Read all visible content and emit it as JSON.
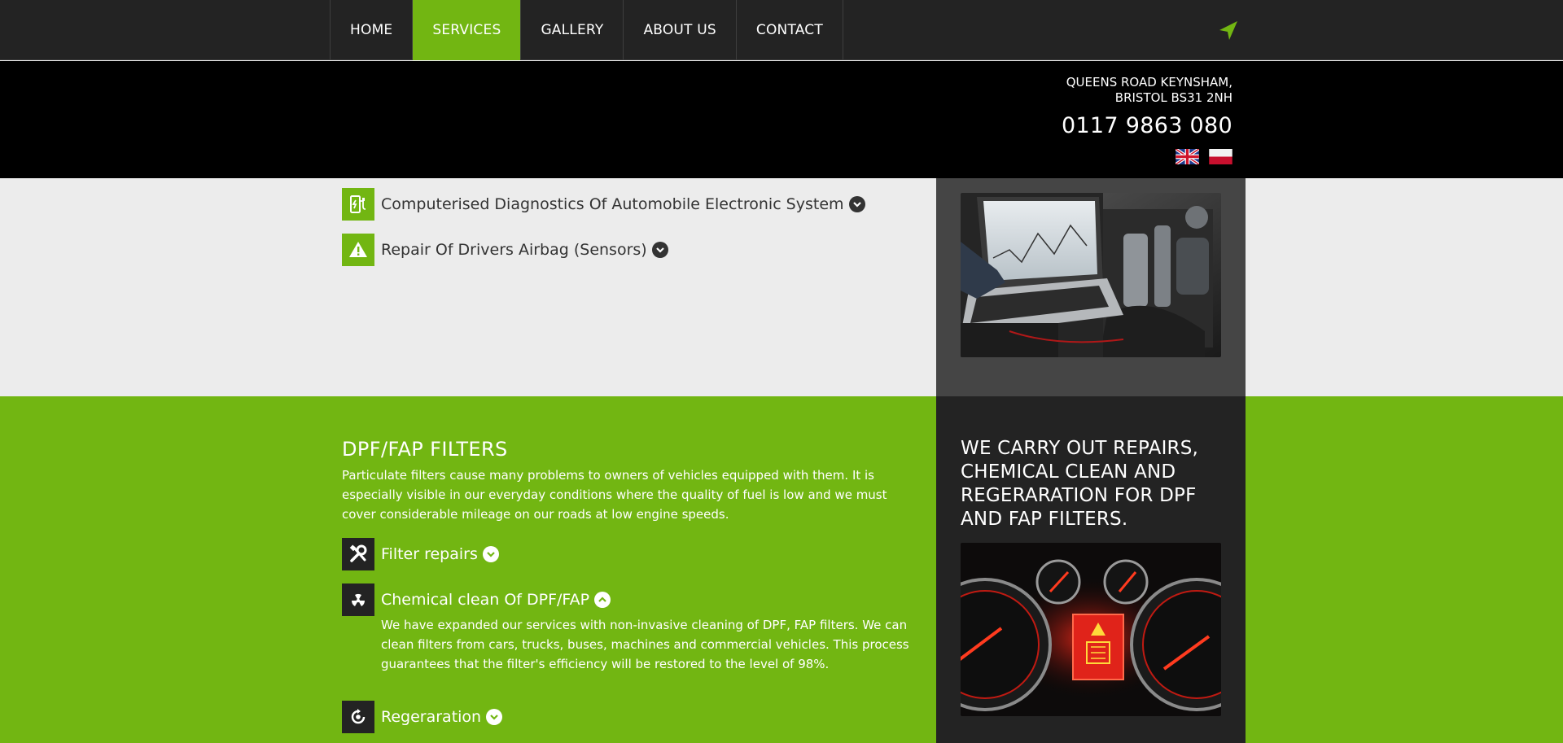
{
  "nav": {
    "items": [
      {
        "label": "HOME"
      },
      {
        "label": "SERVICES"
      },
      {
        "label": "GALLERY"
      },
      {
        "label": "ABOUT US"
      },
      {
        "label": "CONTACT"
      }
    ],
    "active": "SERVICES",
    "locate_icon": "location-arrow-icon"
  },
  "header": {
    "address_line1": "QUEENS ROAD KEYNSHAM,",
    "address_line2": "BRISTOL BS31 2NH",
    "phone": "0117 9863 080",
    "languages": [
      "uk-flag-icon",
      "pl-flag-icon"
    ]
  },
  "diagnostics": {
    "items": [
      {
        "label": "Computerised Diagnostics Of Automobile Electronic System",
        "icon": "diagnostics-plug-icon"
      },
      {
        "label": "Repair Of Drivers Airbag (Sensors)",
        "icon": "warning-icon"
      }
    ]
  },
  "dpf": {
    "title": "DPF/FAP FILTERS",
    "description": "Particulate filters cause many problems to owners of vehicles equipped with them. It is especially visible in our everyday conditions where the quality of fuel is low and we must cover considerable mileage on our roads at low engine speeds.",
    "items": [
      {
        "label": "Filter repairs",
        "icon": "tools-icon"
      },
      {
        "label": "Chemical clean Of DPF/FAP",
        "icon": "radiation-icon"
      },
      {
        "label": "Regeraration",
        "icon": "regeneration-icon"
      }
    ],
    "expanded_text": "We have expanded our services with non-invasive cleaning of DPF, FAP filters. We can clean filters from cars, trucks, buses, machines and commercial vehicles. This process guarantees that the filter's efficiency will be restored to the level of 98%.",
    "side_heading": "WE CARRY OUT REPAIRS, CHEMICAL CLEAN AND REGERARATION FOR DPF AND FAP FILTERS."
  },
  "colors": {
    "accent": "#72b612",
    "nav_bg": "#232323",
    "header_bg": "#000000",
    "light_band": "#ececec",
    "side_grey": "#454545"
  }
}
